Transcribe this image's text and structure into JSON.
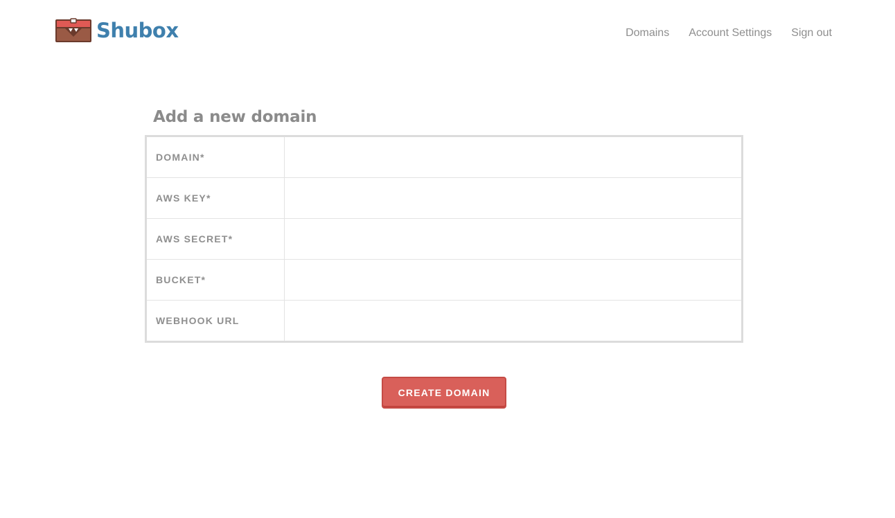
{
  "brand": {
    "name": "Shubox",
    "logo_icon": "treasure-chest-icon",
    "color": "#3f80ad"
  },
  "nav": {
    "items": [
      {
        "label": "Domains"
      },
      {
        "label": "Account Settings"
      },
      {
        "label": "Sign out"
      }
    ]
  },
  "page": {
    "title": "Add a new domain"
  },
  "form": {
    "fields": [
      {
        "label": "DOMAIN*",
        "value": "",
        "placeholder": ""
      },
      {
        "label": "AWS KEY*",
        "value": "",
        "placeholder": ""
      },
      {
        "label": "AWS SECRET*",
        "value": "",
        "placeholder": ""
      },
      {
        "label": "BUCKET*",
        "value": "",
        "placeholder": ""
      },
      {
        "label": "WEBHOOK URL",
        "value": "",
        "placeholder": ""
      }
    ],
    "submit_label": "CREATE DOMAIN"
  },
  "colors": {
    "accent": "#d9605a",
    "label_text": "#8f8f8f",
    "border": "#dcdcdc"
  }
}
